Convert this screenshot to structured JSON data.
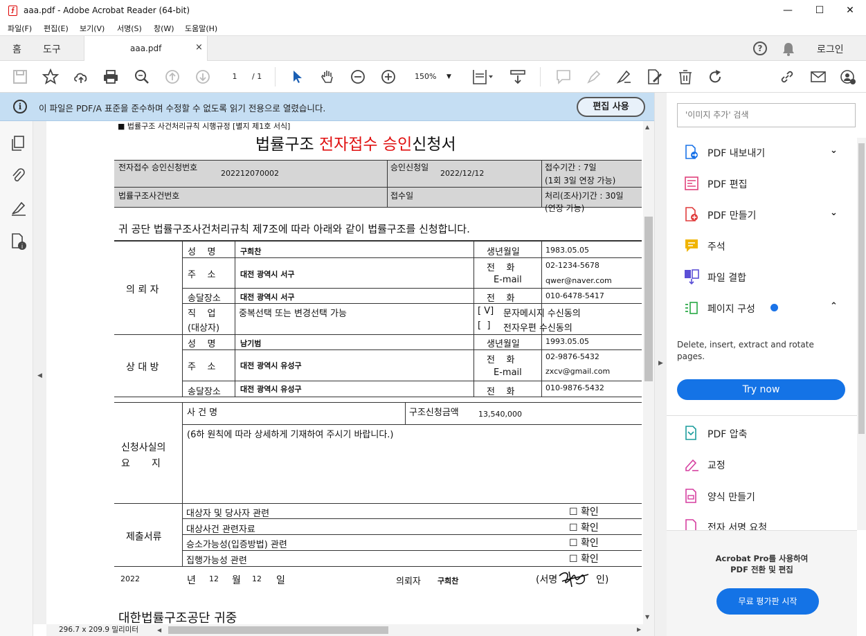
{
  "window": {
    "title": "aaa.pdf - Adobe Acrobat Reader (64-bit)",
    "minimize": "—",
    "maximize": "☐",
    "close": "✕"
  },
  "menu": [
    "파일(F)",
    "편집(E)",
    "보기(V)",
    "서명(S)",
    "창(W)",
    "도움말(H)"
  ],
  "tabs": {
    "home": "홈",
    "tools": "도구",
    "doc": "aaa.pdf",
    "doc_close": "×",
    "login": "로그인"
  },
  "toolbar": {
    "page_current": "1",
    "page_total": "/ 1",
    "zoom": "150%"
  },
  "infobar": {
    "message": "이 파일은 PDF/A 표준을 준수하며 수정할 수 없도록 읽기 전용으로 열렸습니다.",
    "edit_button": "편집 사용"
  },
  "status": {
    "page_size": "296.7 x 209.9 밀리미터"
  },
  "right_pane": {
    "search_placeholder": "'이미지 추가' 검색",
    "tools": [
      {
        "label": "PDF 내보내기",
        "chevron": "⌄",
        "color": "#1a73e8"
      },
      {
        "label": "PDF 편집",
        "chevron": "",
        "color": "#e0407b"
      },
      {
        "label": "PDF 만들기",
        "chevron": "⌄",
        "color": "#e03c3c"
      },
      {
        "label": "주석",
        "chevron": "",
        "color": "#f0b400"
      },
      {
        "label": "파일 결합",
        "chevron": "",
        "color": "#5b4fd6"
      },
      {
        "label": "페이지 구성",
        "chevron": "⌃",
        "color": "#27a844"
      }
    ],
    "organize_desc": "Delete, insert, extract and rotate pages.",
    "try_now": "Try now",
    "tools2": [
      {
        "label": "PDF 압축",
        "color": "#1a9c9c"
      },
      {
        "label": "교정",
        "color": "#d63fa0"
      },
      {
        "label": "양식 만들기",
        "color": "#d63fa0"
      },
      {
        "label": "전자 서명 요청",
        "color": "#d63fa0"
      }
    ],
    "promo_line1": "Acrobat Pro를 사용하여",
    "promo_line2": "PDF 전환 및 편집",
    "promo_button": "무료 평가판 시작"
  },
  "document": {
    "header_note": "■ 법률구조 사건처리규칙 시행규정 [별지 제1호 서식]",
    "title_a": "법률구조 ",
    "title_red": "전자접수 승인",
    "title_b": "신청서",
    "app_no_label": "전자접수 승인신청번호",
    "app_no": "202212070002",
    "app_date_label": "승인신청일",
    "app_date": "2022/12/12",
    "receipt_period_1": "접수기간 : 7일",
    "receipt_period_2": "(1회 3일 연장 가능)",
    "case_no_label": "법률구조사건번호",
    "receipt_date_label": "접수일",
    "process_period_1": "처리(조사)기간 : 30일",
    "process_period_2": "(연장 가능)",
    "intro": "귀 공단 법률구조사건처리규칙 제7조에 따라 아래와 같이 법률구조를 신청합니다.",
    "applicant_label": "의 뢰 자",
    "name_label": "성    명",
    "applicant_name": "구희찬",
    "birth_label": "생년월일",
    "applicant_birth": "1983.05.05",
    "addr_label": "주    소",
    "applicant_addr": "대전 광역시 서구",
    "phone_label": "전    화",
    "applicant_phone": "02-1234-5678",
    "email_label": "E-mail",
    "applicant_email": "qwer@naver.com",
    "delivery_label": "송달장소",
    "applicant_delivery": "대전 광역시 서구",
    "applicant_phone2": "010-6478-5417",
    "job_label": "직    업",
    "job_sub": "(대상자)",
    "job_value": "중복선택 또는 변경선택 가능",
    "sms_check": "[ V]",
    "sms_label": "문자메시지 수신동의",
    "mail_check": "[  ]",
    "mail_label": "전자우편 수신동의",
    "opponent_label": "상 대 방",
    "opponent_name": "남기범",
    "opponent_birth": "1993.05.05",
    "opponent_addr": "대전 광역시 유성구",
    "opponent_phone": "02-9876-5432",
    "opponent_email": "zxcv@gmail.com",
    "opponent_delivery": "대전 광역시 유성구",
    "opponent_phone2": "010-9876-5432",
    "facts_label_1": "신청사실의",
    "facts_label_2": "요       지",
    "case_name_label": "사 건 명",
    "amount_label": "구조신청금액",
    "amount": "13,540,000",
    "facts_note": "(6하 원칙에 따라 상세하게 기재하여 주시기 바랍니다.)",
    "docs_label": "제출서류",
    "docs": [
      {
        "label": "대상자 및 당사자 관련",
        "check": "☐ 확인"
      },
      {
        "label": "대상사건 관련자료",
        "check": "☐ 확인"
      },
      {
        "label": "승소가능성(입증방법) 관련",
        "check": "☐ 확인"
      },
      {
        "label": "집행가능성 관련",
        "check": "☐ 확인"
      }
    ],
    "year": "2022",
    "year_unit": "년",
    "month": "12",
    "month_unit": "월",
    "day": "12",
    "day_unit": "일",
    "signer_label": "의뢰자",
    "signer_name": "구희찬",
    "sign_a": "(서명",
    "sign_b": "인)",
    "addressee": "대한법률구조공단 귀중"
  }
}
